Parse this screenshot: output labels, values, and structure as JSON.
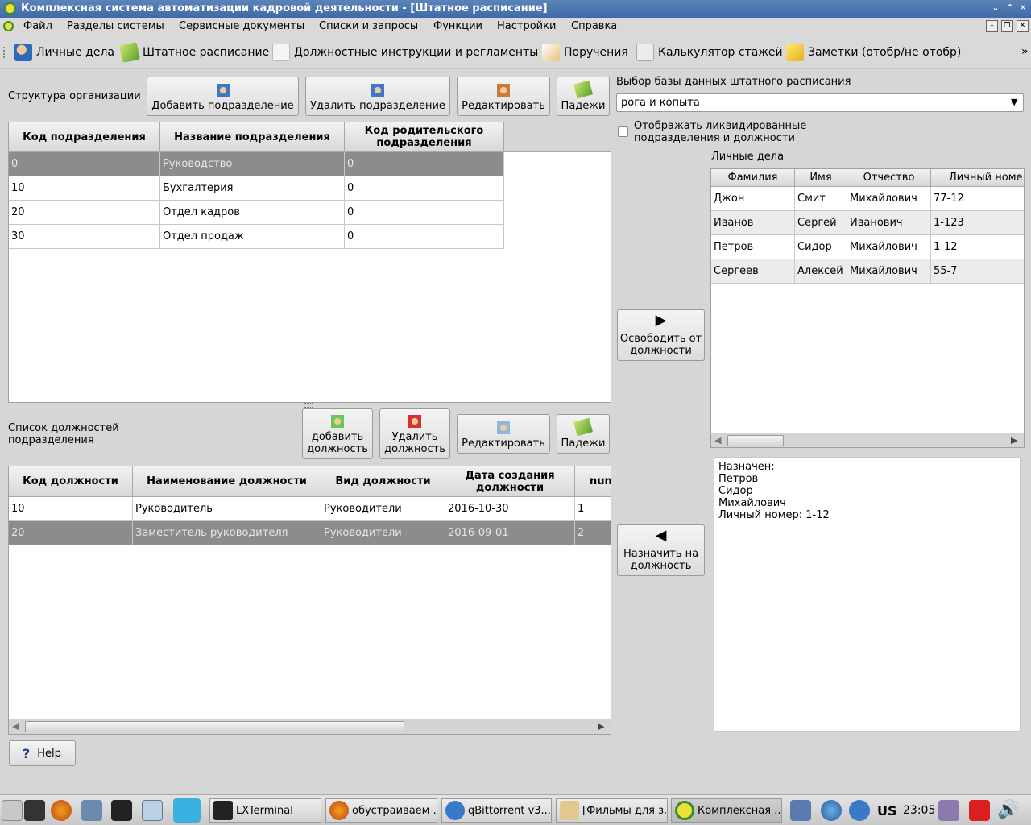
{
  "window": {
    "title": "Комплексная система автоматизации кадровой деятельности - [Штатное расписание]"
  },
  "menu": [
    "Файл",
    "Разделы системы",
    "Сервисные документы",
    "Списки и запросы",
    "Функции",
    "Настройки",
    "Справка"
  ],
  "toolbar": [
    {
      "label": "Личные дела",
      "icon": "people-icon"
    },
    {
      "label": "Штатное расписание",
      "icon": "notepad-icon"
    },
    {
      "label": "Должностные инструкции и регламенты",
      "icon": "magnifier-icon"
    },
    {
      "label": "Поручения",
      "icon": "pen-icon"
    },
    {
      "label": "Калькулятор стажей",
      "icon": "calculator-icon"
    },
    {
      "label": "Заметки (отобр/не отобр)",
      "icon": "notes-icon"
    }
  ],
  "toolbar_more": "»",
  "org": {
    "label": "Структура организации",
    "add_btn": "Добавить подразделение",
    "del_btn": "Удалить подразделение",
    "edit_btn": "Редактировать",
    "cases_btn": "Падежи",
    "columns": [
      "Код подразделения",
      "Название подразделения",
      "Код родительского подразделения"
    ],
    "rows": [
      [
        "0",
        "Руководство",
        "0"
      ],
      [
        "10",
        "Бухгалтерия",
        "0"
      ],
      [
        "20",
        "Отдел кадров",
        "0"
      ],
      [
        "30",
        "Отдел продаж",
        "0"
      ]
    ]
  },
  "positions": {
    "label": "Список должностей подразделения",
    "add_btn": "добавить должность",
    "del_btn": "Удалить должность",
    "edit_btn": "Редактировать",
    "cases_btn": "Падежи",
    "columns": [
      "Код должности",
      "Наименование должности",
      "Вид должности",
      "Дата создания должности",
      "nun"
    ],
    "rows": [
      [
        "10",
        "Руководитель",
        "Руководители",
        "2016-10-30",
        "1"
      ],
      [
        "20",
        "Заместитель руководителя",
        "Руководители",
        "2016-09-01",
        "2"
      ]
    ]
  },
  "db": {
    "label": "Выбор базы данных штатного расписания",
    "selected": "рога и копыта",
    "show_liquidated": "Отображать ликвидированные подразделения и должности"
  },
  "personnel": {
    "label": "Личные дела",
    "columns": [
      "Фамилия",
      "Имя",
      "Отчество",
      "Личный номе"
    ],
    "rows": [
      [
        "Джон",
        "Смит",
        "Михайлович",
        "77-12"
      ],
      [
        "Иванов",
        "Сергей",
        "Иванович",
        "1-123"
      ],
      [
        "Петров",
        "Сидор",
        "Михайлович",
        "1-12"
      ],
      [
        "Сергеев",
        "Алексей",
        "Михайлович",
        "55-7"
      ]
    ]
  },
  "release_btn": "Освободить от должности",
  "assign_btn": "Назначить на должность",
  "assigned_info": [
    "Назначен:",
    "Петров",
    "Сидор",
    "Михайлович",
    "Личный номер: 1-12"
  ],
  "help_btn": "Help",
  "taskbar": {
    "tasks": [
      "LXTerminal",
      "обустраиваем ...",
      "qBittorrent v3....",
      "[Фильмы для з...",
      "Комплексная ..."
    ],
    "lang": "US",
    "clock": "23:05"
  }
}
